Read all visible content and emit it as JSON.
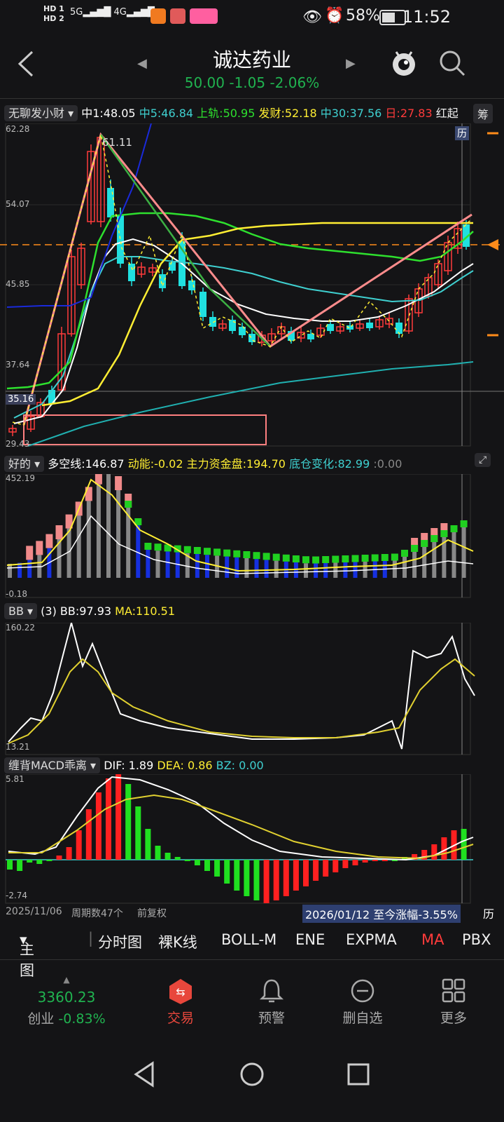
{
  "status": {
    "hd1": "HD 1",
    "hd2": "HD 2",
    "sig1": "5G",
    "sig2": "4G",
    "battery": "58%",
    "time": "11:52"
  },
  "header": {
    "title": "诚达药业",
    "quote": "50.00 -1.05 -2.06%",
    "back_label": "<",
    "prev": "◀",
    "next": "▶"
  },
  "main_indicator": {
    "name": "无聊发小财",
    "items": [
      {
        "label": "中1:48.05",
        "color": "#ffffff"
      },
      {
        "label": "中5:46.84",
        "color": "#3fd0d0"
      },
      {
        "label": "上轨:50.95",
        "color": "#2ee02e"
      },
      {
        "label": "发财:52.18",
        "color": "#ffee33"
      },
      {
        "label": "中30:37.56",
        "color": "#3fd0d0"
      },
      {
        "label": "日:27.83",
        "color": "#ff3b3b"
      },
      {
        "label": "红起",
        "color": "#eeeeee"
      }
    ],
    "badge": "筹",
    "marker": "历",
    "annot_high": "61.11",
    "yticks": [
      "62.28",
      "54.07",
      "45.85",
      "37.64",
      "29.43"
    ],
    "ref_label": "35.16"
  },
  "ind2": {
    "name": "好的",
    "items": [
      {
        "label": "多空线:146.87",
        "color": "#ffffff"
      },
      {
        "label": "动能:-0.02",
        "color": "#ffee33"
      },
      {
        "label": "主力资金盘:194.70",
        "color": "#ffee33"
      },
      {
        "label": "底仓变化:82.99",
        "color": "#3fd0d0"
      },
      {
        "label": ":0.00",
        "color": "#888888"
      }
    ],
    "ymax": "452.19",
    "ymin": "-0.18"
  },
  "ind3": {
    "name": "BB",
    "items": [
      {
        "label": "(3) BB:97.93",
        "color": "#ffffff"
      },
      {
        "label": "MA:110.51",
        "color": "#ffee33"
      }
    ],
    "ymax": "160.22",
    "ymin": "13.21"
  },
  "ind4": {
    "name": "缠背MACD乖离",
    "items": [
      {
        "label": "DIF: 1.89",
        "color": "#ffffff"
      },
      {
        "label": "DEA: 0.86",
        "color": "#ffee33"
      },
      {
        "label": "BZ: 0.00",
        "color": "#3fd0d0"
      }
    ],
    "ymax": "5.81",
    "ymin": "-2.74"
  },
  "footer_info": {
    "date": "2025/11/06",
    "period": "周期数47个",
    "adj": "前复权",
    "range": "2026/01/12 至今涨幅-3.55%",
    "hist": "历"
  },
  "tabs": [
    "主图",
    "分时图",
    "裸K线",
    "BOLL-M",
    "ENE",
    "EXPMA",
    "MA",
    "PBX"
  ],
  "bottom": {
    "index_value": "3360.23",
    "index_name": "创业",
    "index_change": "-0.83%",
    "items": [
      {
        "label": "交易",
        "icon": "trade-icon"
      },
      {
        "label": "预警",
        "icon": "bell-icon"
      },
      {
        "label": "删自选",
        "icon": "remove-icon"
      },
      {
        "label": "更多",
        "icon": "grid-icon"
      }
    ]
  },
  "colors": {
    "up": "#ff3b3b",
    "down": "#20e0e0",
    "bg": "#141416",
    "accent": "#ff6a00"
  }
}
